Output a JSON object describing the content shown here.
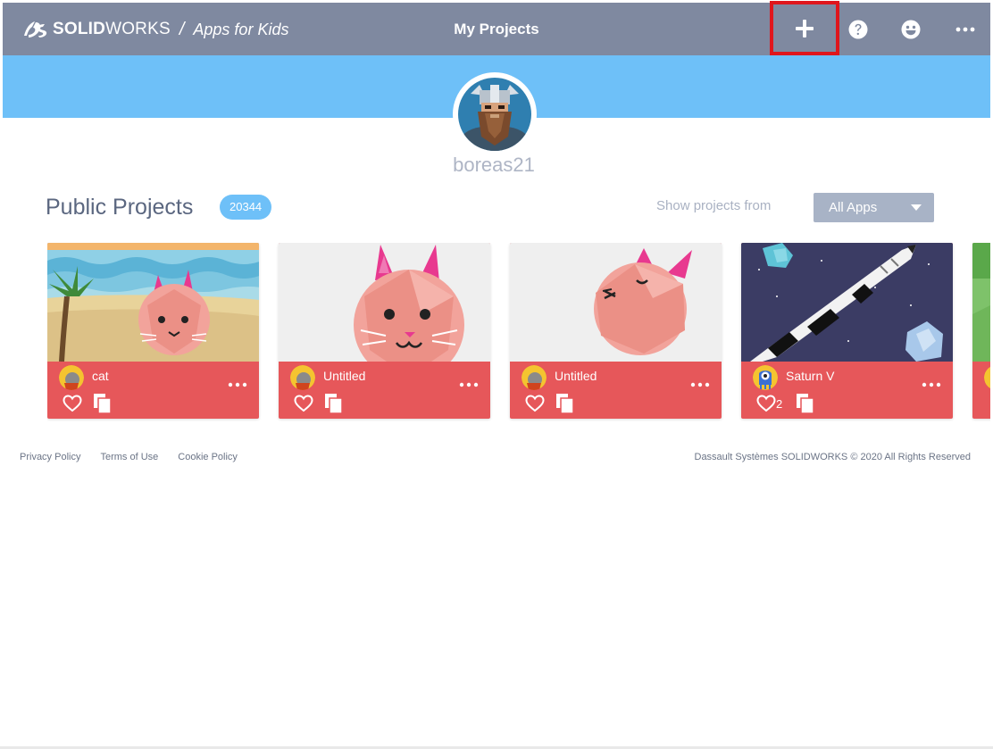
{
  "header": {
    "brand_name_bold": "SOLID",
    "brand_name_rest": "WORKS",
    "brand_separator": "/",
    "brand_sub": "Apps for Kids",
    "title": "My Projects",
    "icons": [
      "plus-icon",
      "help-icon",
      "smile-icon",
      "more-horizontal-icon"
    ]
  },
  "profile": {
    "username": "boreas21"
  },
  "public_projects": {
    "title": "Public Projects",
    "count": "20344",
    "filter_label": "Show projects from",
    "filter_value": "All Apps"
  },
  "projects": [
    {
      "title": "cat",
      "likes": ""
    },
    {
      "title": "Untitled",
      "likes": ""
    },
    {
      "title": "Untitled",
      "likes": ""
    },
    {
      "title": "Saturn V",
      "likes": "2"
    }
  ],
  "footer": {
    "links": [
      "Privacy Policy",
      "Terms of Use",
      "Cookie Policy"
    ],
    "copyright": "Dassault Systèmes SOLIDWORKS © 2020 All Rights Reserved"
  },
  "colors": {
    "header_bg": "#7f89a0",
    "banner_bg": "#6ec0f8",
    "card_bg": "#e6575a",
    "highlight_box": "#e0161c"
  }
}
